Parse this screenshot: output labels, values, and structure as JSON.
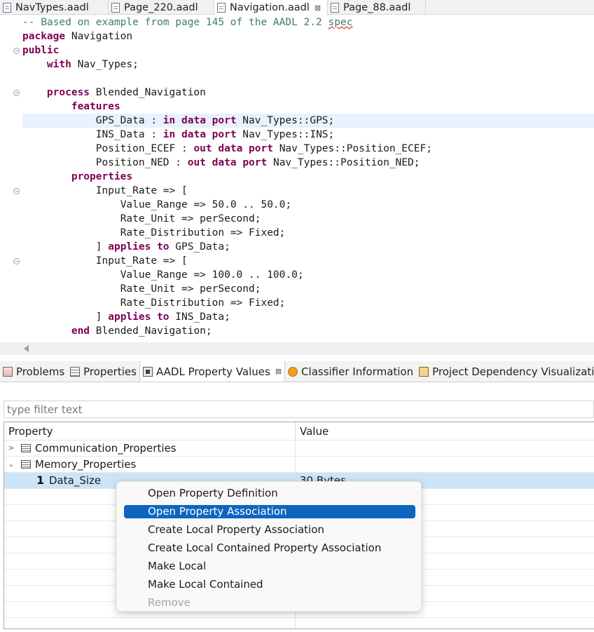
{
  "editor_tabs": [
    {
      "label": "NavTypes.aadl"
    },
    {
      "label": "Page_220.aadl"
    },
    {
      "label": "Navigation.aadl",
      "close": "⊠"
    },
    {
      "label": "Page_88.aadl"
    }
  ],
  "code": {
    "l1": "-- Based on example from page 145 of the AADL 2.2 ",
    "l1_squiggle": "spec",
    "k_package": "package",
    "t_package": " Navigation",
    "k_public": "public",
    "k_with": "with",
    "t_with": " Nav_Types;",
    "k_process": "process",
    "t_process": " Blended_Navigation",
    "k_features": "features",
    "f1_a": "GPS_Data : ",
    "f1_k1": "in",
    "f1_sp": " ",
    "f1_k2": "data",
    "f1_sp2": " ",
    "f1_k3": "port",
    "f1_b": " Nav_Types::GPS;",
    "f2_a": "INS_Data : ",
    "f2_k1": "in",
    "f2_sp": " ",
    "f2_k2": "data",
    "f2_sp2": " ",
    "f2_k3": "port",
    "f2_b": " Nav_Types::INS;",
    "f3_a": "Position_ECEF : ",
    "f3_k1": "out",
    "f3_sp": " ",
    "f3_k2": "data",
    "f3_sp2": " ",
    "f3_k3": "port",
    "f3_b": " Nav_Types::Position_ECEF;",
    "f4_a": "Position_NED : ",
    "f4_k1": "out",
    "f4_sp": " ",
    "f4_k2": "data",
    "f4_sp2": " ",
    "f4_k3": "port",
    "f4_b": " Nav_Types::Position_NED;",
    "k_properties": "properties",
    "ir1": "Input_Rate => [",
    "vr1": "Value_Range => 50.0 .. 50.0;",
    "ru1": "Rate_Unit => perSecond;",
    "rd1": "Rate_Distribution => Fixed;",
    "ap1_a": "] ",
    "ap1_k1": "applies",
    "ap1_sp": " ",
    "ap1_k2": "to",
    "ap1_b": " GPS_Data;",
    "ir2": "Input_Rate => [",
    "vr2": "Value_Range => 100.0 .. 100.0;",
    "ru2": "Rate_Unit => perSecond;",
    "rd2": "Rate_Distribution => Fixed;",
    "ap2_a": "] ",
    "ap2_k1": "applies",
    "ap2_sp": " ",
    "ap2_k2": "to",
    "ap2_b": " INS_Data;",
    "k_end": "end",
    "t_end": " Blended_Navigation;"
  },
  "view_tabs": [
    {
      "label": "Problems",
      "icon": "problems-icon"
    },
    {
      "label": "Properties",
      "icon": "properties-icon"
    },
    {
      "label": "AADL Property Values",
      "icon": "aadl-icon",
      "close": "⊠"
    },
    {
      "label": "Classifier Information",
      "icon": "classifier-icon"
    },
    {
      "label": "Project Dependency Visualizatio",
      "icon": "dependency-icon"
    }
  ],
  "filter": {
    "placeholder": "type filter text"
  },
  "table": {
    "headers": [
      "Property",
      "Value"
    ],
    "rows": [
      {
        "twisty": ">",
        "label": "Communication_Properties",
        "value": ""
      },
      {
        "twisty": "⌄",
        "label": "Memory_Properties",
        "value": ""
      },
      {
        "marker": "1",
        "label": "Data_Size",
        "value": "30 Bytes"
      }
    ]
  },
  "context_menu": {
    "items": [
      {
        "label": "Open Property Definition",
        "state": "normal"
      },
      {
        "label": "Open Property Association",
        "state": "active"
      },
      {
        "label": "Create Local Property Association",
        "state": "normal"
      },
      {
        "label": "Create Local Contained Property Association",
        "state": "normal"
      },
      {
        "label": "Make Local",
        "state": "normal"
      },
      {
        "label": "Make Local Contained",
        "state": "normal"
      },
      {
        "label": "Remove",
        "state": "disabled"
      }
    ]
  },
  "colors": {
    "keyword": "#7f0055",
    "comment": "#3f7f5f",
    "selection": "#cce4f7",
    "menu_active": "#0e65c0"
  }
}
